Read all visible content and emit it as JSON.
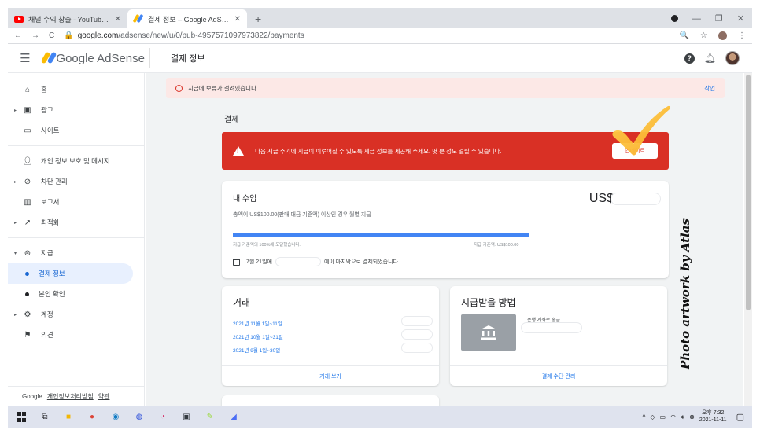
{
  "browser": {
    "tabs": [
      {
        "title": "채널 수익 창출 - YouTube Studio",
        "active": false,
        "icon": "youtube-icon"
      },
      {
        "title": "결제 정보 – Google AdSense",
        "active": true,
        "icon": "adsense-icon"
      }
    ],
    "url_host": "google.com",
    "url_path": "/adsense/new/u/0/pub-4957571097973822/payments"
  },
  "header": {
    "brand": "Google AdSense",
    "page_title": "결제 정보",
    "help_glyph": "?"
  },
  "sidebar": {
    "items": [
      {
        "label": "홈",
        "icon": "home-icon"
      },
      {
        "label": "광고",
        "icon": "ads-icon"
      },
      {
        "label": "사이트",
        "icon": "site-icon"
      },
      {
        "label": "개인 정보 보호 및 메시지",
        "icon": "privacy-icon"
      },
      {
        "label": "차단 관리",
        "icon": "block-icon"
      },
      {
        "label": "보고서",
        "icon": "report-icon"
      },
      {
        "label": "최적화",
        "icon": "optimize-icon"
      },
      {
        "label": "지급",
        "icon": "payments-icon"
      },
      {
        "label": "결제 정보",
        "icon": "dot"
      },
      {
        "label": "본인 확인",
        "icon": "dot"
      },
      {
        "label": "계정",
        "icon": "gear-icon"
      },
      {
        "label": "의견",
        "icon": "feedback-icon"
      }
    ],
    "footer": {
      "brand": "Google",
      "privacy": "개인정보처리방침",
      "terms": "약관"
    }
  },
  "banner": {
    "text": "지급에 보류가 걸려있습니다.",
    "action": "작업"
  },
  "section_title": "결제",
  "alert": {
    "text": "다음 지급 주기에 지급이 이루어질 수 있도록 세금 정보를 제공해 주세요. 몇 분 정도 걸릴 수 있습니다.",
    "button": "업데이트"
  },
  "earnings": {
    "title": "내 수입",
    "amount_prefix": "US$",
    "desc": "총액이 US$100.00(판매 대금 기준액) 이상인 경우 월별 지급",
    "progress_pct": 100,
    "progress_left": "지급 기준액의 100%에 도달했습니다.",
    "progress_right": "지급 기준액: US$100.00",
    "note_date": "7월 21일에",
    "note_rest": "에이 마지막으로 결제되었습니다."
  },
  "transactions": {
    "title": "거래",
    "items": [
      "2021년 11월 1일~11일",
      "2021년 10월 1일~31일",
      "2021년 9월 1일~30일"
    ],
    "footer_link": "거래 보기"
  },
  "payment_method": {
    "title": "지급받을 방법",
    "bank_label": "은행 계좌로 송금",
    "footer_link": "결제 수단 관리"
  },
  "watermark": "Photo artwork by Atlas",
  "taskbar": {
    "time_period": "오후 7:32",
    "date": "2021-11-11"
  },
  "colors": {
    "alert_red": "#d93025",
    "link_blue": "#1a73e8",
    "progress_blue": "#4285f4",
    "banner_pink": "#fce8e6"
  }
}
